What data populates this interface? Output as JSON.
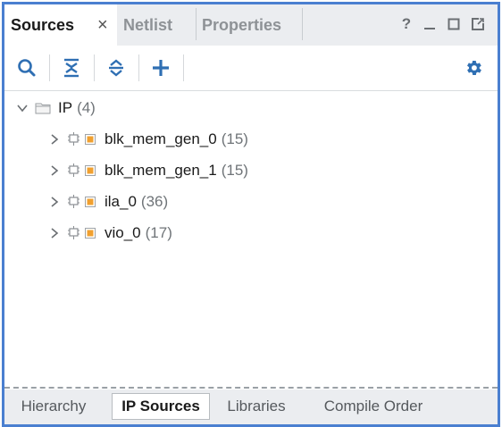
{
  "tabs": [
    {
      "label": "Sources",
      "active": true,
      "close": "×"
    },
    {
      "label": "Netlist",
      "active": false
    },
    {
      "label": "Properties",
      "active": false
    }
  ],
  "window_controls": {
    "help": "?",
    "minimize_icon": "minimize-icon",
    "maximize_icon": "maximize-icon",
    "float_icon": "float-icon"
  },
  "toolbar": {
    "icons": [
      "search-icon",
      "collapse-all-icon",
      "expand-all-icon",
      "add-icon",
      "gear-icon"
    ]
  },
  "tree": {
    "root": {
      "label": "IP",
      "count": "(4)",
      "icon": "folder-icon",
      "expanded": true
    },
    "items": [
      {
        "label": "blk_mem_gen_0",
        "count": "(15)"
      },
      {
        "label": "blk_mem_gen_1",
        "count": "(15)"
      },
      {
        "label": "ila_0",
        "count": "(36)"
      },
      {
        "label": "vio_0",
        "count": "(17)"
      }
    ]
  },
  "bottom_tabs": [
    {
      "label": "Hierarchy",
      "active": false
    },
    {
      "label": "IP Sources",
      "active": true
    },
    {
      "label": "Libraries",
      "active": false
    },
    {
      "label": "Compile Order",
      "active": false
    }
  ],
  "colors": {
    "frame_border": "#4a7fd0",
    "accent_icon": "#2f6fb3",
    "ip_orange": "#f0a030",
    "tab_bg": "#ebedf0"
  }
}
